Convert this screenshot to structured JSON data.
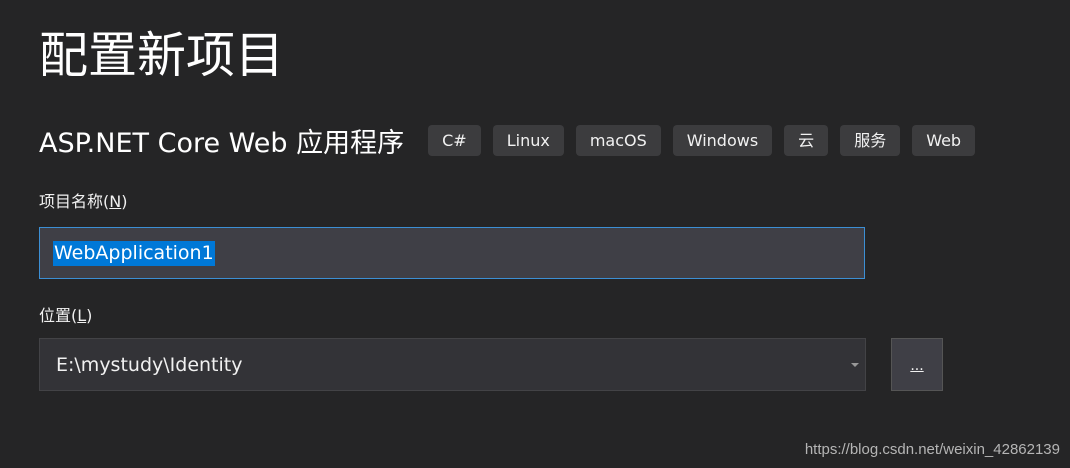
{
  "header": {
    "title": "配置新项目"
  },
  "template": {
    "name": "ASP.NET Core Web 应用程序",
    "tags": [
      "C#",
      "Linux",
      "macOS",
      "Windows",
      "云",
      "服务",
      "Web"
    ]
  },
  "project_name": {
    "label_text": "项目名称(",
    "label_mnemonic": "N",
    "label_suffix": ")",
    "value": "WebApplication1"
  },
  "location": {
    "label_text": "位置(",
    "label_mnemonic": "L",
    "label_suffix": ")",
    "value": "E:\\mystudy\\Identity",
    "browse_label": "..."
  },
  "watermark": "https://blog.csdn.net/weixin_42862139",
  "colors": {
    "background": "#252526",
    "input_border_focus": "#3c8fd4",
    "selection": "#0078d7",
    "tag_background": "#3c3c3e"
  }
}
